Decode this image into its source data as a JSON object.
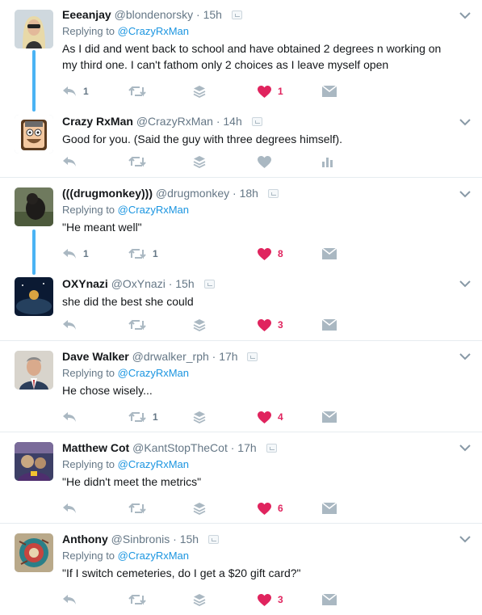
{
  "colors": {
    "link": "#1b95e0",
    "liked": "#e0245e",
    "icon": "#aab8c2",
    "thread_line": "#4ab3f4"
  },
  "icons": {
    "reply": "reply-icon",
    "retweet": "retweet-icon",
    "layers": "layers-icon",
    "like": "heart-icon",
    "dm": "envelope-icon",
    "analytics": "bar-chart-icon",
    "more": "chevron-down-icon"
  },
  "tweets": [
    {
      "name": "Eeeanjay",
      "handle": "@blondenorsky",
      "dot": "·",
      "time": "15h",
      "reply_prefix": "Replying to",
      "reply_to": "@CrazyRxMan",
      "text": "As I did and went back to school and have obtained 2 degrees n working on my third one. I can't fathom only 2 choices as I leave myself open",
      "reply_count": "1",
      "retweet_count": "",
      "like_count": "1",
      "liked": true
    },
    {
      "name": "Crazy RxMan",
      "handle": "@CrazyRxMan",
      "dot": "·",
      "time": "14h",
      "reply_prefix": "",
      "reply_to": "",
      "text": "Good for you. (Said the guy with three degrees himself).",
      "reply_count": "",
      "retweet_count": "",
      "like_count": "",
      "liked": false
    },
    {
      "name": "(((drugmonkey)))",
      "handle": "@drugmonkey",
      "dot": "·",
      "time": "18h",
      "reply_prefix": "Replying to",
      "reply_to": "@CrazyRxMan",
      "text": "\"He meant well\"",
      "reply_count": "1",
      "retweet_count": "1",
      "like_count": "8",
      "liked": true
    },
    {
      "name": "OXYnazi",
      "handle": "@OxYnazi",
      "dot": "·",
      "time": "15h",
      "reply_prefix": "",
      "reply_to": "",
      "text": "she did the best she could",
      "reply_count": "",
      "retweet_count": "",
      "like_count": "3",
      "liked": true
    },
    {
      "name": "Dave Walker",
      "handle": "@drwalker_rph",
      "dot": "·",
      "time": "17h",
      "reply_prefix": "Replying to",
      "reply_to": "@CrazyRxMan",
      "text": "He chose wisely...",
      "reply_count": "",
      "retweet_count": "1",
      "like_count": "4",
      "liked": true
    },
    {
      "name": "Matthew Cot",
      "handle": "@KantStopTheCot",
      "dot": "·",
      "time": "17h",
      "reply_prefix": "Replying to",
      "reply_to": "@CrazyRxMan",
      "text": "\"He didn't meet the metrics\"",
      "reply_count": "",
      "retweet_count": "",
      "like_count": "6",
      "liked": true
    },
    {
      "name": "Anthony",
      "handle": "@Sinbronis",
      "dot": "·",
      "time": "15h",
      "reply_prefix": "Replying to",
      "reply_to": "@CrazyRxMan",
      "text": "\"If I switch cemeteries, do I get a $20 gift card?\"",
      "reply_count": "",
      "retweet_count": "",
      "like_count": "3",
      "liked": true
    }
  ]
}
